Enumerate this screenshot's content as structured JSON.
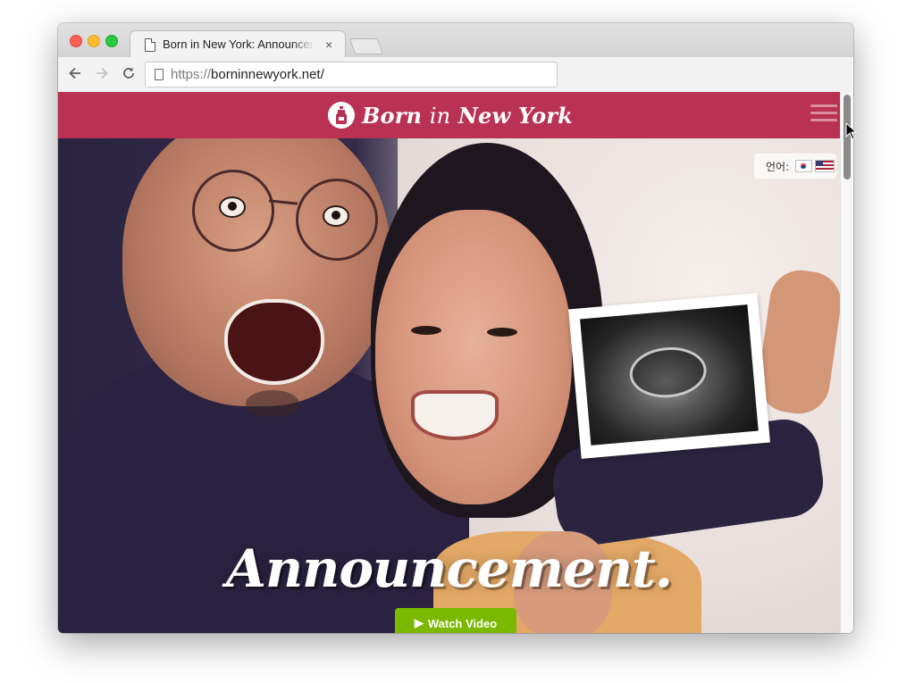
{
  "browser": {
    "tab_title": "Born in New York: Announcement",
    "tab_close": "×",
    "url_scheme": "https://",
    "url_host": "borninnewyork.net/",
    "back_icon": "arrow-left-icon",
    "forward_icon": "arrow-right-icon",
    "reload_icon": "reload-icon"
  },
  "site": {
    "logo_word1": "Born",
    "logo_word2": "in",
    "logo_word3": "New York",
    "brand_color": "#b93153",
    "language_label": "언어:",
    "headline": "Announcement.",
    "cta_label": "Watch Video",
    "cta_icon": "▶",
    "cta_color": "#7bb800"
  }
}
